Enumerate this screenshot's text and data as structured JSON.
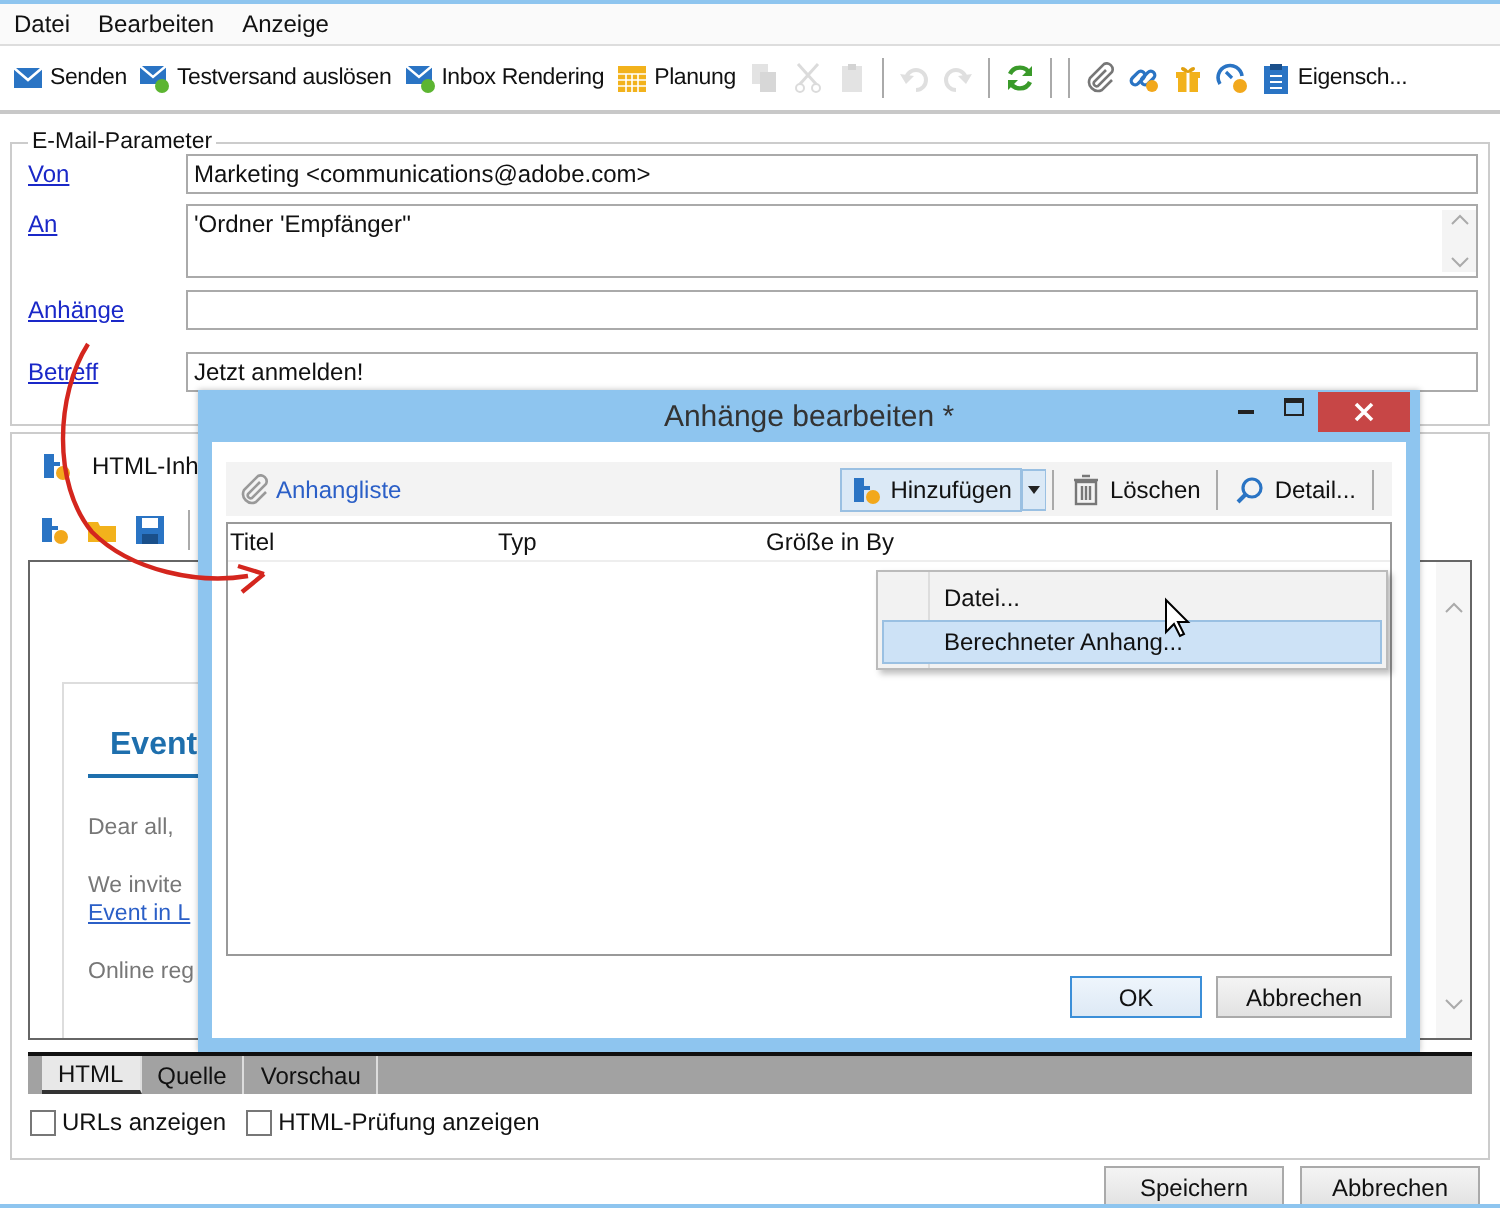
{
  "menu": [
    {
      "label": "Datei"
    },
    {
      "label": "Bearbeiten"
    },
    {
      "label": "Anzeige"
    }
  ],
  "toolbar": [
    {
      "kind": "button",
      "label": "Senden",
      "disabled": false
    },
    {
      "kind": "button",
      "label": "Testversand auslösen",
      "disabled": false
    },
    {
      "kind": "button",
      "label": "Inbox Rendering",
      "disabled": false
    },
    {
      "kind": "button",
      "label": "Planung",
      "disabled": false
    },
    {
      "kind": "button",
      "disabled": true
    },
    {
      "kind": "button",
      "disabled": true
    },
    {
      "kind": "button",
      "disabled": true
    },
    {
      "kind": "separator"
    },
    {
      "kind": "button",
      "disabled": true
    },
    {
      "kind": "button",
      "disabled": true
    },
    {
      "kind": "separator"
    },
    {
      "kind": "button",
      "disabled": false
    },
    {
      "kind": "separator"
    },
    {
      "kind": "separator"
    },
    {
      "kind": "button",
      "disabled": false
    },
    {
      "kind": "button",
      "disabled": false
    },
    {
      "kind": "button",
      "disabled": false
    },
    {
      "kind": "button",
      "disabled": false
    },
    {
      "kind": "button",
      "label": "Eigensch...",
      "disabled": false
    }
  ],
  "email_parameters": {
    "title": "E-Mail-Parameter",
    "fields": [
      {
        "label": "Von",
        "kind": "single",
        "value": "Marketing <communications@adobe.com>"
      },
      {
        "label": "An",
        "kind": "multi",
        "value": "'Ordner 'Empfänger''"
      },
      {
        "label": "Anhänge",
        "kind": "single"
      },
      {
        "label": "Betreff",
        "kind": "single",
        "value": "Jetzt anmelden!"
      }
    ]
  },
  "content_tab": {
    "label": "HTML-Inh"
  },
  "preview": {
    "heading": "Event",
    "greeting": "Dear all,",
    "line": "We invite",
    "link": "Event in L",
    "footer": "Online reg"
  },
  "view_tabs": [
    {
      "label": "HTML",
      "selected": true
    },
    {
      "label": "Quelle",
      "selected": false
    },
    {
      "label": "Vorschau",
      "selected": false
    }
  ],
  "options": [
    {
      "label": "URLs anzeigen",
      "checked": false
    },
    {
      "label": "HTML-Prüfung anzeigen",
      "checked": false
    }
  ],
  "buttons": [
    {
      "label": "Speichern"
    },
    {
      "label": "Abbrechen"
    }
  ],
  "dialog": {
    "title": "Anhänge bearbeiten *",
    "list_label": "Anhangliste",
    "toolbar": [
      {
        "label": "Hinzufügen",
        "pressed": true
      },
      {
        "label": "Löschen",
        "pressed": false
      },
      {
        "label": "Detail...",
        "pressed": false
      }
    ],
    "columns": [
      "Titel",
      "Typ",
      "Größe in By"
    ],
    "menu": [
      {
        "label": "Datei...",
        "selected": false
      },
      {
        "label": "Berechneter Anhang...",
        "selected": true
      }
    ],
    "buttons": [
      {
        "label": "OK",
        "default": true
      },
      {
        "label": "Abbrechen",
        "default": false
      }
    ]
  }
}
